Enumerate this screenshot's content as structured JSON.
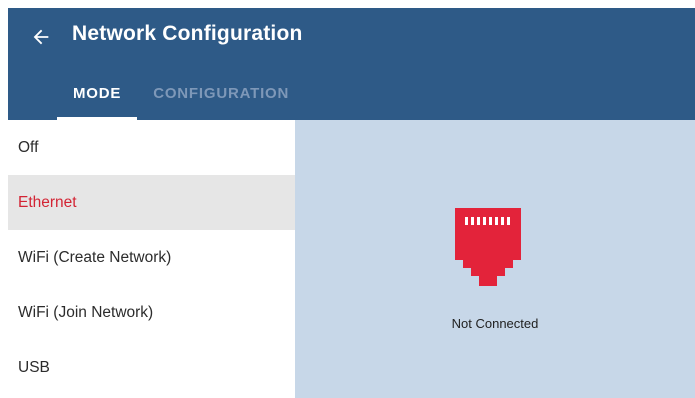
{
  "header": {
    "title": "Network Configuration",
    "back_icon": "arrow-left-icon"
  },
  "tabs": [
    {
      "label": "MODE",
      "active": true
    },
    {
      "label": "CONFIGURATION",
      "active": false
    }
  ],
  "mode_list": {
    "items": [
      {
        "label": "Off"
      },
      {
        "label": "Ethernet",
        "selected": true
      },
      {
        "label": "WiFi (Create Network)"
      },
      {
        "label": "WiFi (Join Network)"
      },
      {
        "label": "USB"
      }
    ]
  },
  "status_panel": {
    "icon": "ethernet-port-icon",
    "status": "Not Connected"
  },
  "colors": {
    "appbar": "#2e5a87",
    "accent": "#d32434",
    "panel": "#c7d7e8",
    "selected_bg": "#e6e6e6"
  }
}
